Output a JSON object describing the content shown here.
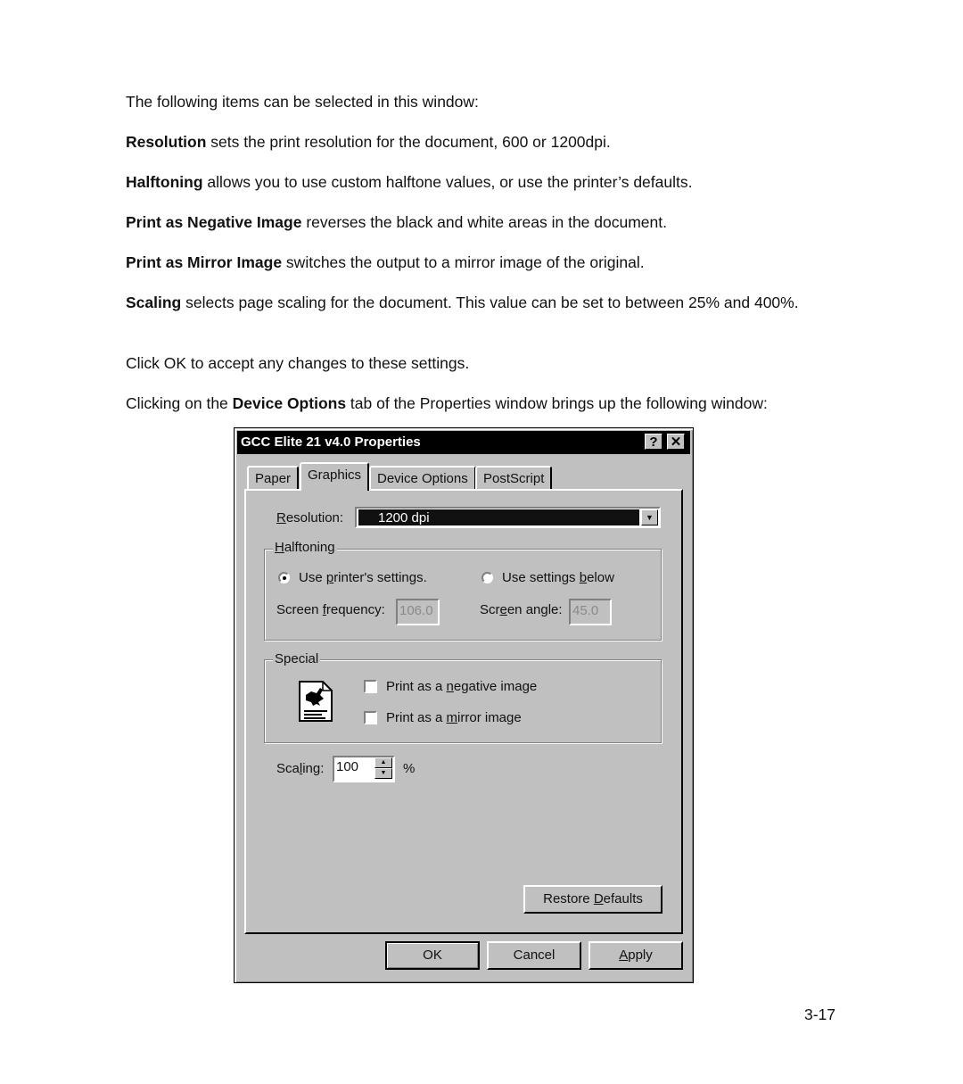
{
  "document": {
    "intro": "The following items can be selected in this window:",
    "items": [
      {
        "term": "Resolution",
        "desc": " sets the print resolution for the document, 600 or 1200dpi."
      },
      {
        "term": "Halftoning",
        "desc": " allows you to use custom halftone values, or use the printer’s defaults."
      },
      {
        "term": "Print as Negative Image",
        "desc": " reverses the black and white areas in the document."
      },
      {
        "term": "Print as Mirror Image",
        "desc": " switches the output to a mirror image of the original."
      },
      {
        "term": "Scaling",
        "desc": " selects page scaling for the document. This value can be set to between 25% and 400%."
      }
    ],
    "ok_note": "Click OK to accept any changes to these settings.",
    "device_pre": "Clicking on the ",
    "device_term": "Device Options",
    "device_post": " tab of the Properties window brings up the following window:",
    "page_number": "3-17"
  },
  "dialog": {
    "title": "GCC Elite 21 v4.0 Properties",
    "help_icon": "?",
    "close_icon": "✕",
    "tabs": [
      {
        "label": "Paper",
        "active": false
      },
      {
        "label": "Graphics",
        "active": true
      },
      {
        "label": "Device Options",
        "active": false
      },
      {
        "label": "PostScript",
        "active": false
      }
    ],
    "resolution": {
      "label_u": "R",
      "label_rest": "esolution:",
      "selected": "1200 dpi"
    },
    "halftoning": {
      "group_u": "H",
      "group_rest": "alftoning",
      "option1": {
        "pre": "Use ",
        "u": "p",
        "post": "rinter's settings.",
        "checked": true
      },
      "option2": {
        "pre": "Use settings ",
        "u": "b",
        "post": "elow",
        "checked": false
      },
      "freq_label": {
        "pre": "Screen ",
        "u": "f",
        "post": "requency:"
      },
      "freq_value": "106.0",
      "angle_label": {
        "pre": "Scr",
        "u": "e",
        "post": "en angle:"
      },
      "angle_value": "45.0"
    },
    "special": {
      "group_label": "Special",
      "icon": "printer-document-icon",
      "negative": {
        "pre": "Print as a ",
        "u": "n",
        "post": "egative image",
        "checked": false
      },
      "mirror": {
        "pre": "Print as a ",
        "u": "m",
        "post": "irror image",
        "checked": false
      }
    },
    "scaling": {
      "pre": "Sca",
      "u": "l",
      "post": "ing:",
      "value": "100",
      "unit": "%"
    },
    "restore": {
      "pre": "Restore ",
      "u": "D",
      "post": "efaults"
    },
    "buttons": {
      "ok": "OK",
      "cancel": "Cancel",
      "apply_u": "A",
      "apply_rest": "pply"
    }
  }
}
